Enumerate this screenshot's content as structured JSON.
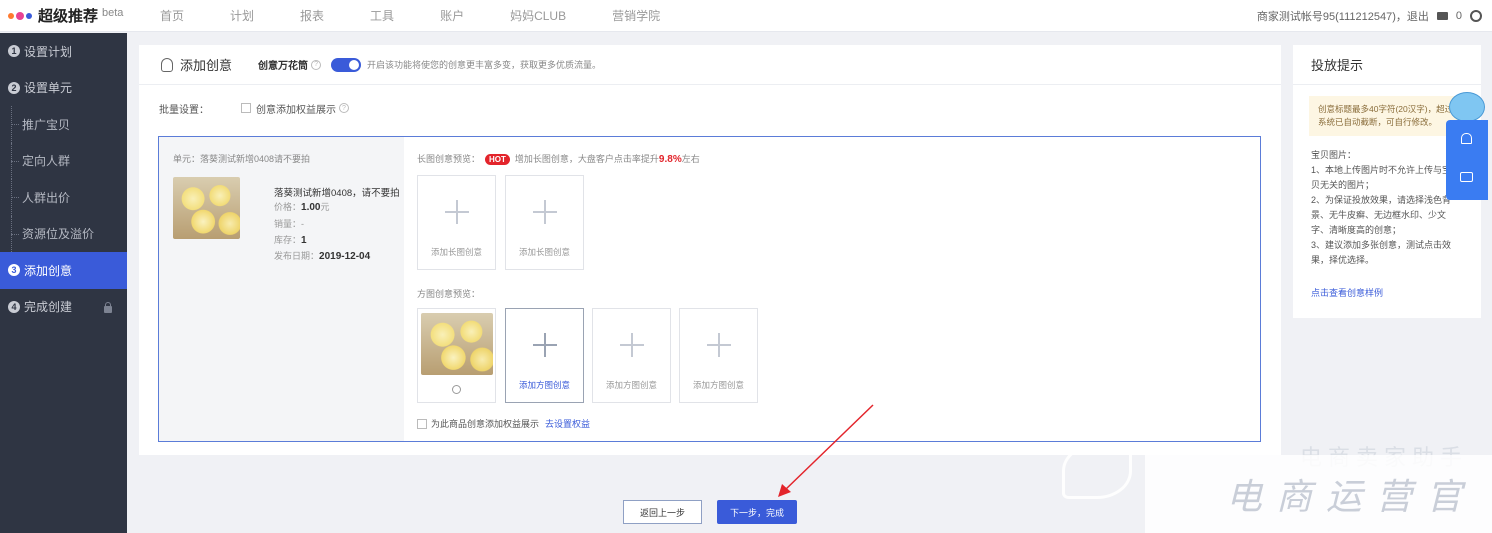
{
  "topbar": {
    "logo_title": "超级推荐",
    "logo_beta": "beta",
    "brand_colors": [
      "#ff7a2f",
      "#e84393",
      "#3a5bd9"
    ],
    "nav": [
      "首页",
      "计划",
      "报表",
      "工具",
      "账户",
      "妈妈CLUB",
      "营销学院"
    ],
    "account_text": "商家测试帐号95(111212547)，退出",
    "mail_count": "0"
  },
  "sidebar": {
    "items": [
      {
        "num": "1",
        "label": "设置计划"
      },
      {
        "num": "2",
        "label": "设置单元"
      },
      {
        "label": "推广宝贝"
      },
      {
        "label": "定向人群"
      },
      {
        "label": "人群出价"
      },
      {
        "label": "资源位及溢价"
      },
      {
        "num": "3",
        "label": "添加创意"
      },
      {
        "num": "4",
        "label": "完成创建"
      }
    ]
  },
  "main": {
    "title": "添加创意",
    "sub_title": "创意万花筒",
    "toggle_on": true,
    "toggle_desc": "开启该功能将使您的创意更丰富多变，获取更多优质流量。",
    "batch_label": "批量设置：",
    "batch_checkbox": "创意添加权益展示",
    "unit": {
      "name": "单元：落葵测试新增0408请不要拍",
      "goods_title": "落葵测试新增0408，请不要拍",
      "price_label": "价格：",
      "price_value": "1.00",
      "price_unit": "元",
      "sales_label": "销量：",
      "sales_value": "-",
      "stock_label": "库存：",
      "stock_value": "1",
      "date_label": "发布日期：",
      "date_value": "2019-12-04"
    },
    "long_preview_label": "长图创意预览：",
    "hot_badge": "HOT",
    "long_hint": "增加长图创意，大盘客户点击率提升",
    "long_hint_pct": "9.8%",
    "long_hint_suffix": "左右",
    "long_add_labels": [
      "添加长图创意",
      "添加长图创意"
    ],
    "square_preview_label": "方图创意预览：",
    "square_add_labels": [
      "添加方图创意",
      "添加方图创意",
      "添加方图创意"
    ],
    "equity_checkbox": "为此商品创意添加权益展示",
    "equity_link": "去设置权益"
  },
  "tips": {
    "title": "投放提示",
    "note_line1": "创意标题最多40字符(20汉字)，超过",
    "note_line2": "系统已自动截断，可自行修改。",
    "body": [
      "宝贝图片：",
      "1、本地上传图片时不允许上传与宝",
      "贝无关的图片；",
      "2、为保证投放效果，请选择浅色背",
      "景、无牛皮癣、无边框水印、少文",
      "字、清晰度高的创意；",
      "3、建议添加多张创意，测试点击效",
      "果，择优选择。"
    ],
    "link": "点击查看创意样例"
  },
  "buttons": {
    "back": "返回上一步",
    "next": "下一步，完成"
  },
  "watermark": {
    "line1": "电商卖家助手",
    "line2": "电商运营官"
  }
}
